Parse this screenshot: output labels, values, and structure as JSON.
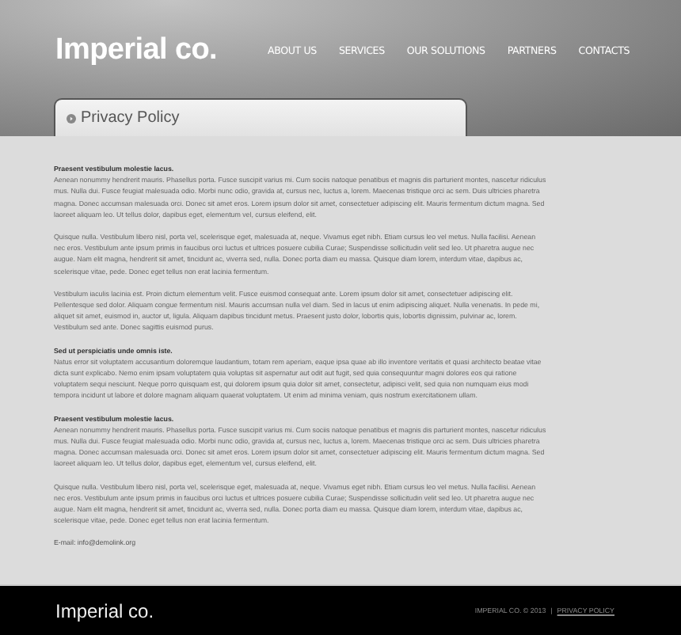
{
  "header": {
    "logo": "Imperial co.",
    "nav": [
      "ABOUT US",
      "SERVICES",
      "OUR SOLUTIONS",
      "PARTNERS",
      "CONTACTS"
    ]
  },
  "page_tab": {
    "title": "Privacy Policy"
  },
  "content": [
    {
      "kind": "heading",
      "text": "Praesent vestibulum molestie lacus."
    },
    {
      "kind": "paragraph",
      "text": "Aenean nonummy hendrerit mauris. Phasellus porta. Fusce suscipit varius mi. Cum sociis natoque penatibus et magnis dis parturient montes, nascetur ridiculus mus. Nulla dui. Fusce feugiat malesuada odio. Morbi nunc odio, gravida at, cursus nec, luctus a, lorem. Maecenas tristique orci ac sem. Duis ultricies pharetra magna. Donec accumsan malesuada orci. Donec sit amet eros. Lorem ipsum dolor sit amet, consectetuer adipiscing elit. Mauris fermentum dictum magna. Sed laoreet aliquam leo. Ut tellus dolor, dapibus eget, elementum vel, cursus eleifend, elit."
    },
    {
      "kind": "paragraph",
      "text": "Quisque nulla. Vestibulum libero nisl, porta vel, scelerisque eget, malesuada at, neque. Vivamus eget nibh. Etiam cursus leo vel metus. Nulla facilisi. Aenean nec eros. Vestibulum ante ipsum primis in faucibus orci luctus et ultrices posuere cubilia Curae; Suspendisse sollicitudin velit sed leo. Ut pharetra augue nec augue. Nam elit magna, hendrerit sit amet, tincidunt ac, viverra sed, nulla. Donec porta diam eu massa. Quisque diam lorem, interdum vitae, dapibus ac, scelerisque vitae, pede. Donec eget tellus non erat lacinia fermentum."
    },
    {
      "kind": "paragraph",
      "text": "Vestibulum iaculis lacinia est. Proin dictum elementum velit. Fusce euismod consequat ante. Lorem ipsum dolor sit amet, consectetuer adipiscing elit. Pellentesque sed dolor. Aliquam congue fermentum nisl. Mauris accumsan nulla vel diam. Sed in lacus ut enim adipiscing aliquet. Nulla venenatis. In pede mi, aliquet sit amet, euismod in, auctor ut, ligula. Aliquam dapibus tincidunt metus. Praesent justo dolor, lobortis quis, lobortis dignissim, pulvinar ac, lorem. Vestibulum sed ante. Donec sagittis euismod purus."
    },
    {
      "kind": "heading",
      "text": "Sed ut perspiciatis unde omnis iste."
    },
    {
      "kind": "paragraph",
      "text": "Natus error sit voluptatem accusantium doloremque laudantium, totam rem aperiam, eaque ipsa quae ab illo inventore veritatis et quasi architecto beatae vitae dicta sunt explicabo. Nemo enim ipsam voluptatem quia voluptas sit aspernatur aut odit aut fugit, sed quia consequuntur magni dolores eos qui ratione voluptatem sequi nesciunt. Neque porro quisquam est, qui dolorem ipsum quia dolor sit amet, consectetur, adipisci velit, sed quia non numquam eius modi tempora incidunt ut labore et dolore magnam aliquam quaerat voluptatem. Ut enim ad minima veniam, quis nostrum exercitationem ullam."
    },
    {
      "kind": "heading",
      "text": "Praesent vestibulum molestie lacus."
    },
    {
      "kind": "paragraph",
      "text": "Aenean nonummy hendrerit mauris. Phasellus porta. Fusce suscipit varius mi. Cum sociis natoque penatibus et magnis dis parturient montes, nascetur ridiculus mus. Nulla dui. Fusce feugiat malesuada odio. Morbi nunc odio, gravida at, cursus nec, luctus a, lorem. Maecenas tristique orci ac sem. Duis ultricies pharetra magna. Donec accumsan malesuada orci. Donec sit amet eros. Lorem ipsum dolor sit amet, consectetuer adipiscing elit. Mauris fermentum dictum magna. Sed laoreet aliquam leo. Ut tellus dolor, dapibus eget, elementum vel, cursus eleifend, elit."
    },
    {
      "kind": "paragraph",
      "text": "Quisque nulla. Vestibulum libero nisl, porta vel, scelerisque eget, malesuada at, neque. Vivamus eget nibh. Etiam cursus leo vel metus. Nulla facilisi. Aenean nec eros. Vestibulum ante ipsum primis in faucibus orci luctus et ultrices posuere cubilia Curae; Suspendisse sollicitudin velit sed leo. Ut pharetra augue nec augue. Nam elit magna, hendrerit sit amet, tincidunt ac, viverra sed, nulla. Donec porta diam eu massa. Quisque diam lorem, interdum vitae, dapibus ac, scelerisque vitae, pede. Donec eget tellus non erat lacinia fermentum."
    },
    {
      "kind": "email",
      "text": "E-mail: info@demolink.org"
    }
  ],
  "footer": {
    "logo": "Imperial co.",
    "copyright": "IMPERIAL CO. © 2013",
    "separator": "|",
    "link": "PRIVACY POLICY"
  }
}
